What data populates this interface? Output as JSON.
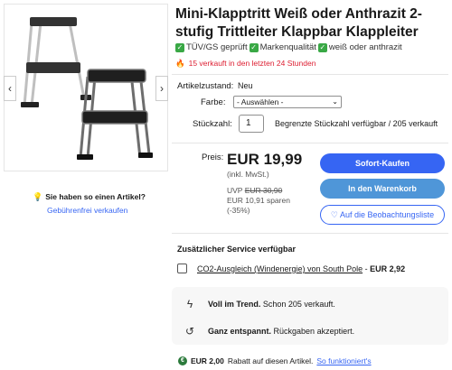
{
  "product": {
    "title": "Mini-Klapptritt Weiß oder Anthrazit 2-stufig Trittleiter Klappbar Klappleiter",
    "features": [
      "TÜV/GS geprüft",
      "Markenqualität",
      "weiß oder anthrazit"
    ],
    "trending": "15 verkauft in den letzten 24 Stunden"
  },
  "gallery": {
    "prev": "‹",
    "next": "›"
  },
  "seller_tip": {
    "question": "Sie haben so einen Artikel?",
    "link": "Gebührenfrei verkaufen"
  },
  "details": {
    "condition_label": "Artikelzustand:",
    "condition_value": "Neu",
    "color_label": "Farbe:",
    "color_value": "- Auswählen -",
    "qty_label": "Stückzahl:",
    "qty_value": "1",
    "qty_note": "Begrenzte Stückzahl verfügbar / 205 verkauft"
  },
  "price": {
    "label": "Preis:",
    "value": "EUR 19,99",
    "incl": "(inkl. MwSt.)",
    "uvp_label": "UVP",
    "uvp_value": "EUR 30,90",
    "save": "EUR 10,91 sparen",
    "percent": "(-35%)"
  },
  "buttons": {
    "buy": "Sofort-Kaufen",
    "cart": "In den Warenkorb",
    "watch": "Auf die Beobachtungsliste"
  },
  "extra": {
    "title": "Zusätzlicher Service verfügbar",
    "co2_link": "CO2-Ausgleich (Windenergie) von South Pole",
    "co2_sep": " - ",
    "co2_price": "EUR 2,92"
  },
  "info": {
    "trend_bold": "Voll im Trend.",
    "trend_text": "Schon 205 verkauft.",
    "return_bold": "Ganz entspannt.",
    "return_text": "Rückgaben akzeptiert."
  },
  "promo": {
    "amount": "EUR 2,00",
    "text": "Rabatt auf diesen Artikel.",
    "link": "So funktioniert's"
  },
  "colors": {
    "accent": "#3665f3",
    "cart": "#4f96d8",
    "trending": "#dd1e31",
    "check": "#39a845"
  }
}
